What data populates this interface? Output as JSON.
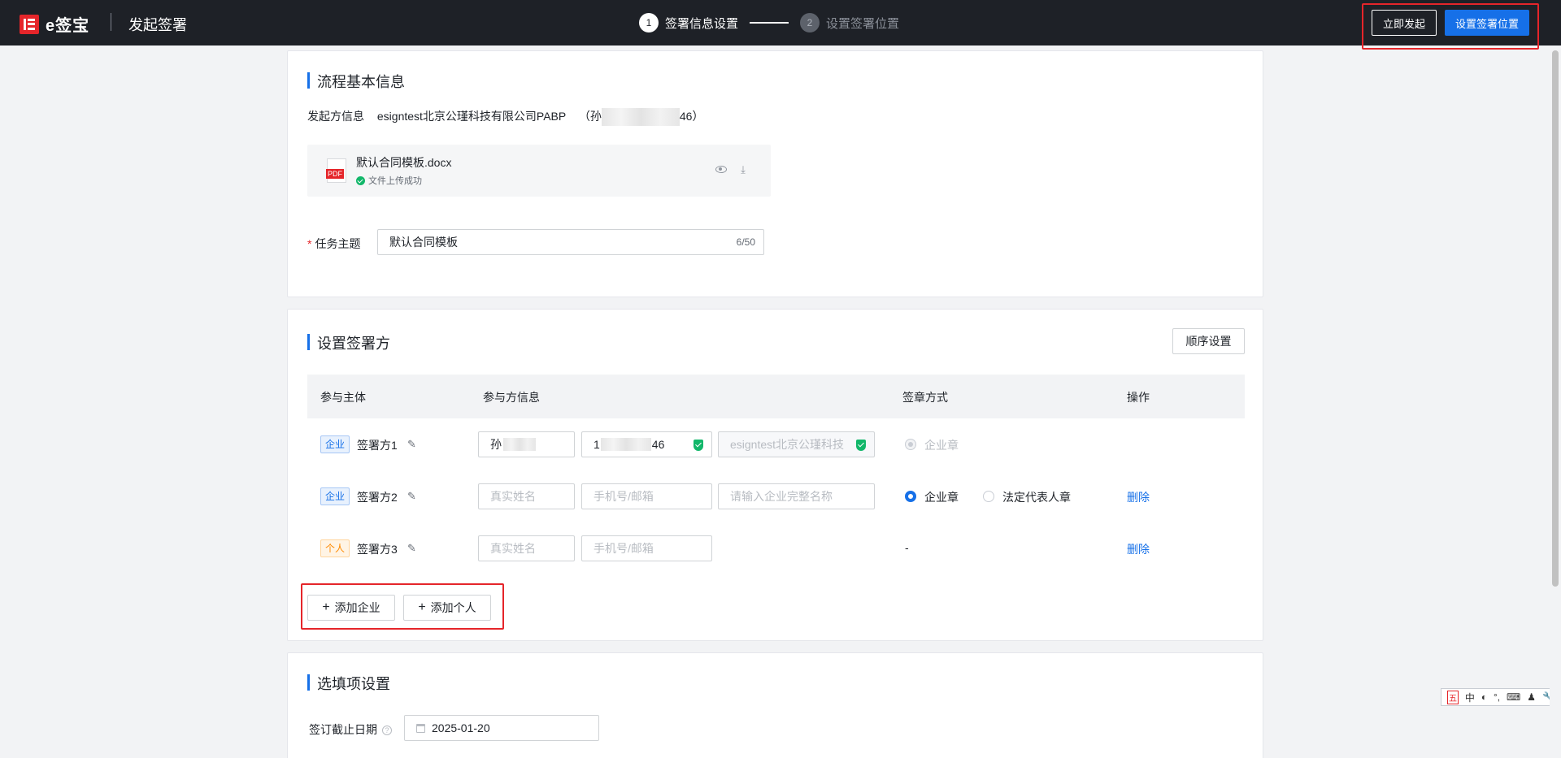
{
  "header": {
    "logo_text": "e签宝",
    "page_name": "发起签署",
    "steps": [
      {
        "num": "1",
        "label": "签署信息设置"
      },
      {
        "num": "2",
        "label": "设置签署位置"
      }
    ],
    "launch_now": "立即发起",
    "set_position": "设置签署位置"
  },
  "basic_info": {
    "title": "流程基本信息",
    "initiator_label": "发起方信息",
    "initiator_value": "esigntest北京公瑾科技有限公司PABP",
    "initiator_person_prefix": "（孙",
    "initiator_person_suffix": "46）",
    "file": {
      "name": "默认合同模板.docx",
      "type": "PDF",
      "status": "文件上传成功"
    },
    "subject_label": "任务主题",
    "subject_value": "默认合同模板",
    "subject_counter": "6/50"
  },
  "signers": {
    "title": "设置签署方",
    "order_button": "顺序设置",
    "columns": [
      "参与主体",
      "参与方信息",
      "签章方式",
      "操作"
    ],
    "rows": [
      {
        "tag": "企业",
        "name": "签署方1",
        "name_value": "孙",
        "phone_value": "1",
        "phone_suffix": "46",
        "company_value": "esigntest北京公瑾科技",
        "seal": "企业章"
      },
      {
        "tag": "企业",
        "name": "签署方2",
        "name_placeholder": "真实姓名",
        "phone_placeholder": "手机号/邮箱",
        "company_placeholder": "请输入企业完整名称",
        "seal_options": [
          "企业章",
          "法定代表人章"
        ],
        "action": "删除"
      },
      {
        "tag": "个人",
        "name": "签署方3",
        "name_placeholder": "真实姓名",
        "phone_placeholder": "手机号/邮箱",
        "seal": "-",
        "action": "删除"
      }
    ],
    "add_company": "添加企业",
    "add_person": "添加个人"
  },
  "options": {
    "title": "选填项设置",
    "deadline_label": "签订截止日期",
    "deadline_value": "2025-01-20"
  },
  "ime": {
    "items": [
      "五",
      "中",
      "◐",
      "°,",
      "⌨",
      "♟",
      "🔧"
    ]
  },
  "colors": {
    "accent": "#1670e8",
    "header_bg": "#1e2127",
    "highlight": "#e5252a",
    "success": "#12b76a"
  }
}
